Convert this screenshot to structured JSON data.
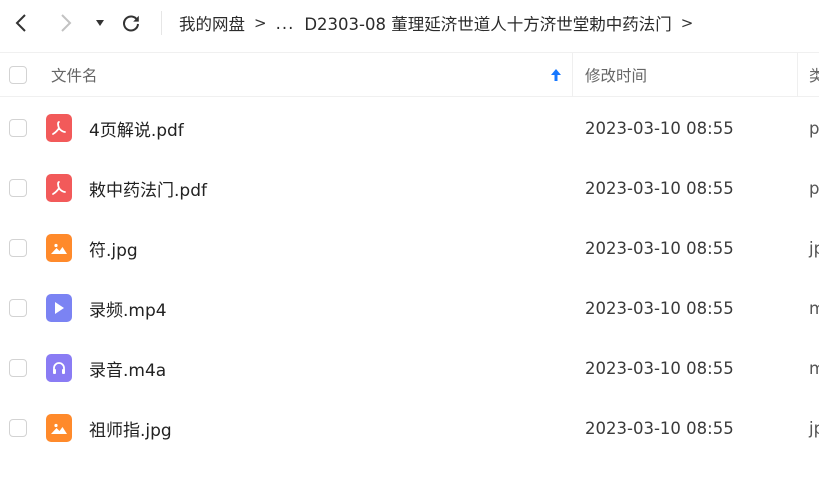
{
  "nav": {
    "back_icon": "chevron-left-icon",
    "forward_icon": "chevron-right-icon",
    "history_icon": "caret-down-icon",
    "refresh_icon": "refresh-icon"
  },
  "breadcrumb": {
    "root": "我的网盘",
    "separator": ">",
    "ellipsis": "...",
    "current": "D2303-08 董理延济世道人十方济世堂勅中药法门",
    "trailing_separator": ">"
  },
  "table": {
    "columns": {
      "name": "文件名",
      "modified": "修改时间",
      "type": "类"
    },
    "sort": {
      "column": "name",
      "direction": "ascending",
      "icon": "sort-up-arrow-icon",
      "color": "#1677ff"
    },
    "rows": [
      {
        "name": "4页解说.pdf",
        "modified": "2023-03-10 08:55",
        "type": "p",
        "icon": "pdf-icon",
        "icon_color": "#f25a5a"
      },
      {
        "name": "敕中药法门.pdf",
        "modified": "2023-03-10 08:55",
        "type": "p",
        "icon": "pdf-icon",
        "icon_color": "#f25a5a"
      },
      {
        "name": "符.jpg",
        "modified": "2023-03-10 08:55",
        "type": "jp",
        "icon": "image-icon",
        "icon_color": "#ff8a2b"
      },
      {
        "name": "录频.mp4",
        "modified": "2023-03-10 08:55",
        "type": "m",
        "icon": "video-icon",
        "icon_color": "#7b83f3"
      },
      {
        "name": "录音.m4a",
        "modified": "2023-03-10 08:55",
        "type": "m",
        "icon": "audio-icon",
        "icon_color": "#8a7cf4"
      },
      {
        "name": "祖师指.jpg",
        "modified": "2023-03-10 08:55",
        "type": "jp",
        "icon": "image-icon",
        "icon_color": "#ff8a2b"
      }
    ]
  }
}
